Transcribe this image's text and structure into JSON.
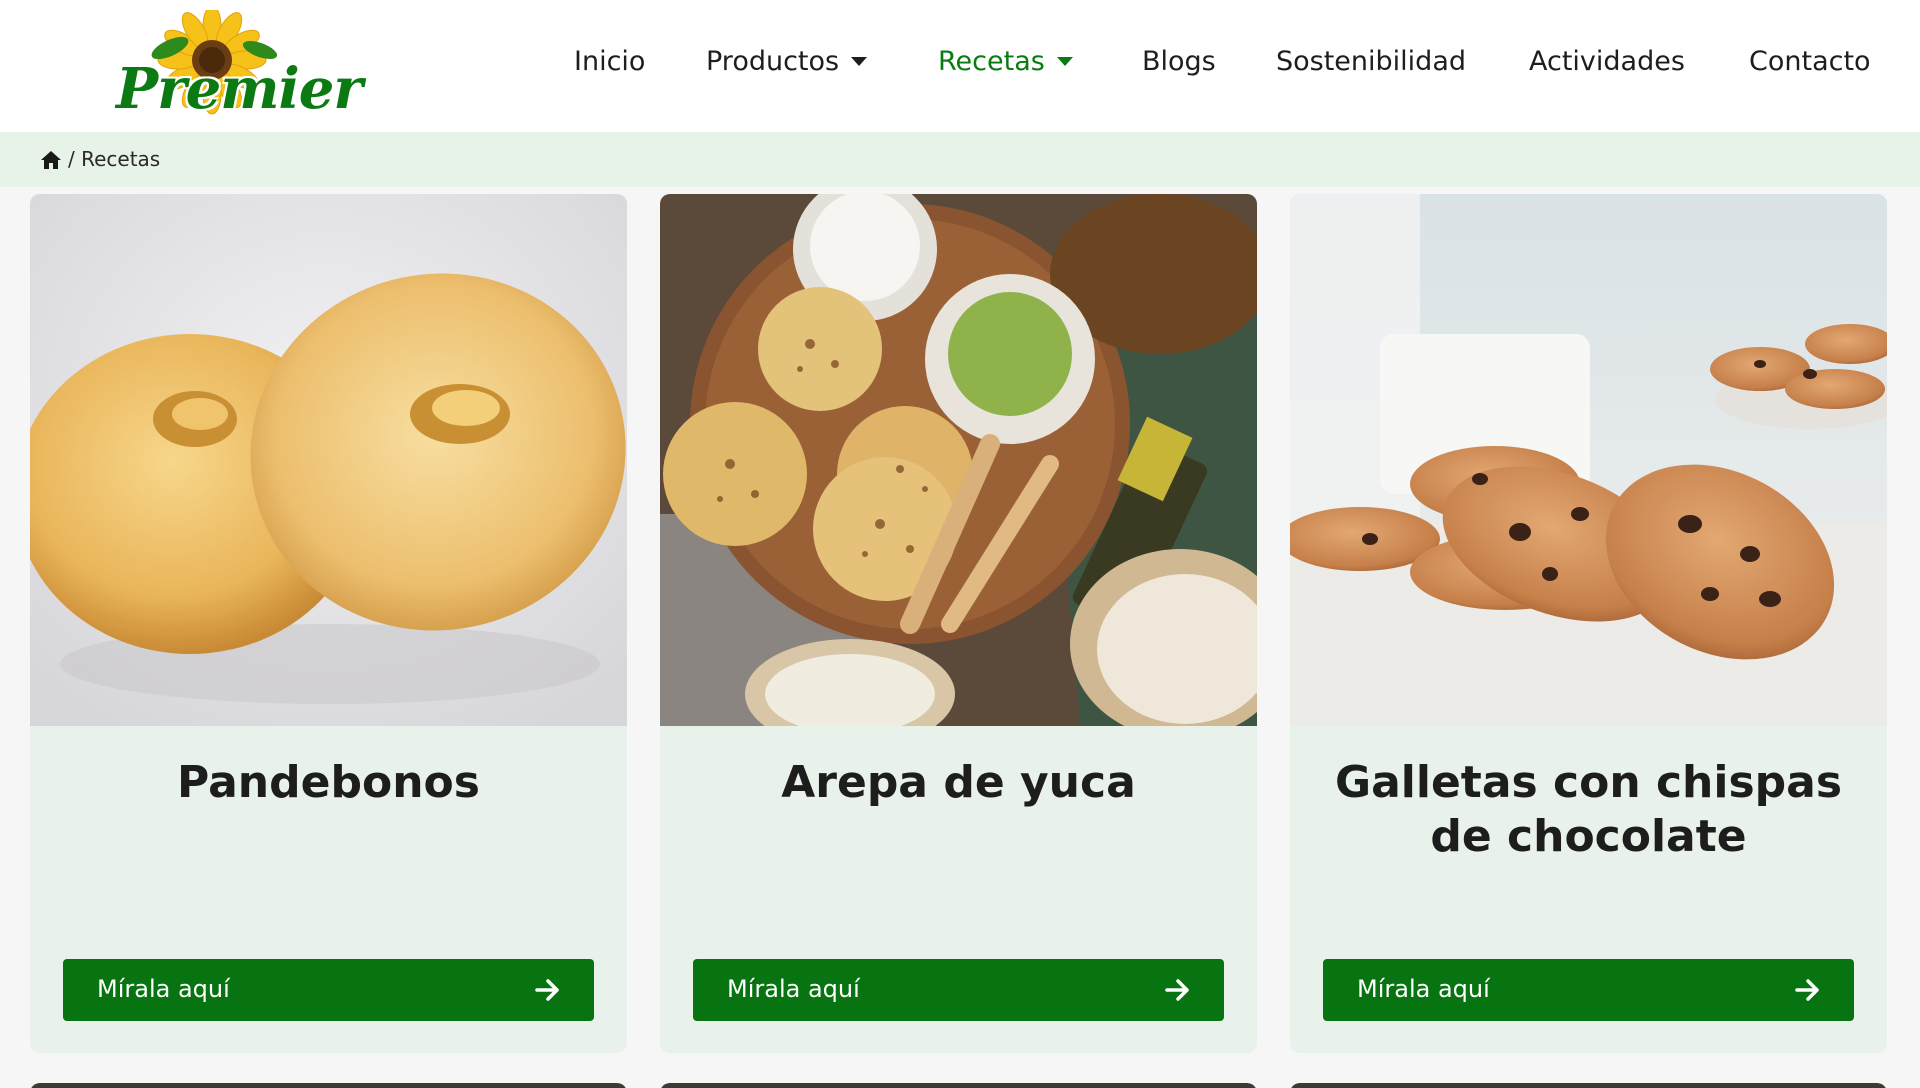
{
  "brand": {
    "logo_text": "Premier",
    "accent_color": "#087411",
    "breadcrumb_bg": "#e7f2e9"
  },
  "nav": {
    "items": [
      {
        "label": "Inicio",
        "has_caret": false,
        "active": false
      },
      {
        "label": "Productos",
        "has_caret": true,
        "active": false
      },
      {
        "label": "Recetas",
        "has_caret": true,
        "active": true
      },
      {
        "label": "Blogs",
        "has_caret": false,
        "active": false
      },
      {
        "label": "Sostenibilidad",
        "has_caret": false,
        "active": false
      },
      {
        "label": "Actividades",
        "has_caret": false,
        "active": false
      },
      {
        "label": "Contacto",
        "has_caret": false,
        "active": false
      }
    ]
  },
  "breadcrumb": {
    "home_icon": "home-icon",
    "text": "/ Recetas"
  },
  "cards": [
    {
      "title": "Pandebonos",
      "image": "pandebonos-photo",
      "button_label": "Mírala aquí",
      "button_icon": "arrow-right-icon"
    },
    {
      "title": "Arepa de yuca",
      "image": "arepa-de-yuca-photo",
      "button_label": "Mírala aquí",
      "button_icon": "arrow-right-icon"
    },
    {
      "title": "Galletas con chispas de chocolate",
      "image": "galletas-photo",
      "button_label": "Mírala aquí",
      "button_icon": "arrow-right-icon"
    }
  ]
}
